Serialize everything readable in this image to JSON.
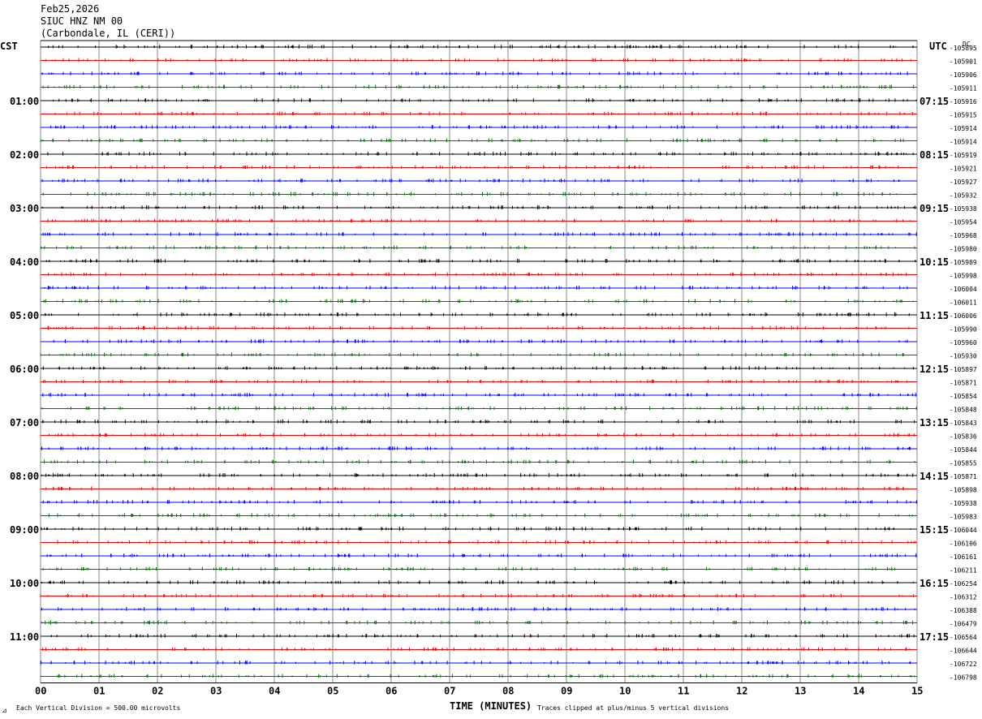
{
  "header": {
    "date": "Feb25,2026",
    "station": "SIUC HNZ NM 00",
    "location": "(Carbondale, IL (CERI))"
  },
  "left_axis_label": "CST",
  "right_axis_label": "UTC",
  "dc_label": "DC",
  "footer": {
    "scale": "Each Vertical Division =  500.00 microvolts",
    "clip_note": "Traces clipped at plus/minus 5 vertical divisions"
  },
  "chart_data": {
    "type": "line",
    "title": "",
    "xlabel": "TIME (MINUTES)",
    "xlim": [
      0,
      15
    ],
    "x_ticks": [
      "00",
      "01",
      "02",
      "03",
      "04",
      "05",
      "06",
      "07",
      "08",
      "09",
      "10",
      "11",
      "12",
      "13",
      "14",
      "15"
    ],
    "trace_colors": [
      "#000000",
      "#ff0000",
      "#0000ff",
      "#007700"
    ],
    "trace_count": 48,
    "cst_labels": [
      "01:00",
      "02:00",
      "03:00",
      "04:00",
      "05:00",
      "06:00",
      "07:00",
      "08:00",
      "09:00",
      "10:00",
      "11:00"
    ],
    "utc_labels": [
      "07:15",
      "08:15",
      "09:15",
      "10:15",
      "11:15",
      "12:15",
      "13:15",
      "14:15",
      "15:15",
      "16:15",
      "17:15"
    ],
    "dc_offsets": [
      "-105895",
      "-105901",
      "-105906",
      "-105911",
      "-105916",
      "-105915",
      "-105914",
      "-105914",
      "-105919",
      "-105921",
      "-105927",
      "-105932",
      "-105938",
      "-105954",
      "-105968",
      "-105980",
      "-105989",
      "-105998",
      "-106004",
      "-106011",
      "-106006",
      "-105990",
      "-105960",
      "-105930",
      "-105897",
      "-105871",
      "-105854",
      "-105848",
      "-105843",
      "-105836",
      "-105844",
      "-105855",
      "-105871",
      "-105898",
      "-105938",
      "-105983",
      "-106044",
      "-106106",
      "-106161",
      "-106211",
      "-106254",
      "-106312",
      "-106388",
      "-106479",
      "-106564",
      "-106644",
      "-106722",
      "-106798"
    ]
  }
}
